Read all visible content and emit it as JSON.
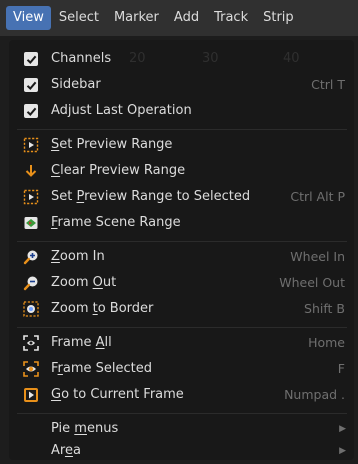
{
  "menubar": {
    "items": [
      "View",
      "Select",
      "Marker",
      "Add",
      "Track",
      "Strip"
    ]
  },
  "background_ticks": [
    "20",
    "30",
    "40"
  ],
  "menu": {
    "channels": {
      "label": "Channels"
    },
    "sidebar": {
      "label": "Sidebar",
      "shortcut": "Ctrl T"
    },
    "adjust_last": {
      "label": "Adjust Last Operation"
    },
    "set_preview_range": {
      "pre": "",
      "ul": "S",
      "post": "et Preview Range"
    },
    "clear_preview_range": {
      "pre": "",
      "ul": "C",
      "post": "lear Preview Range"
    },
    "set_preview_selected": {
      "pre": "Set ",
      "ul": "P",
      "post": "review Range to Selected",
      "shortcut": "Ctrl Alt P"
    },
    "frame_scene_range": {
      "pre": "",
      "ul": "F",
      "post": "rame Scene Range"
    },
    "zoom_in": {
      "pre": "",
      "ul": "Z",
      "post": "oom In",
      "shortcut": "Wheel In"
    },
    "zoom_out": {
      "pre": "Zoom ",
      "ul": "O",
      "post": "ut",
      "shortcut": "Wheel Out"
    },
    "zoom_border": {
      "pre": "Zoom ",
      "ul": "t",
      "post": "o Border",
      "shortcut": "Shift B"
    },
    "frame_all": {
      "pre": "Frame ",
      "ul": "A",
      "post": "ll",
      "shortcut": "Home"
    },
    "frame_selected": {
      "pre": "F",
      "ul": "r",
      "post": "ame Selected",
      "shortcut": "F"
    },
    "goto_current": {
      "pre": "",
      "ul": "G",
      "post": "o to Current Frame",
      "shortcut": "Numpad ."
    },
    "pie_menus": {
      "pre": "Pie ",
      "ul": "m",
      "post": "enus"
    },
    "area": {
      "pre": "Ar",
      "ul": "e",
      "post": "a"
    }
  },
  "colors": {
    "accent": "#4772b3",
    "orange": "#e8901a",
    "menu_bg": "#181818",
    "bar_bg": "#303030"
  }
}
